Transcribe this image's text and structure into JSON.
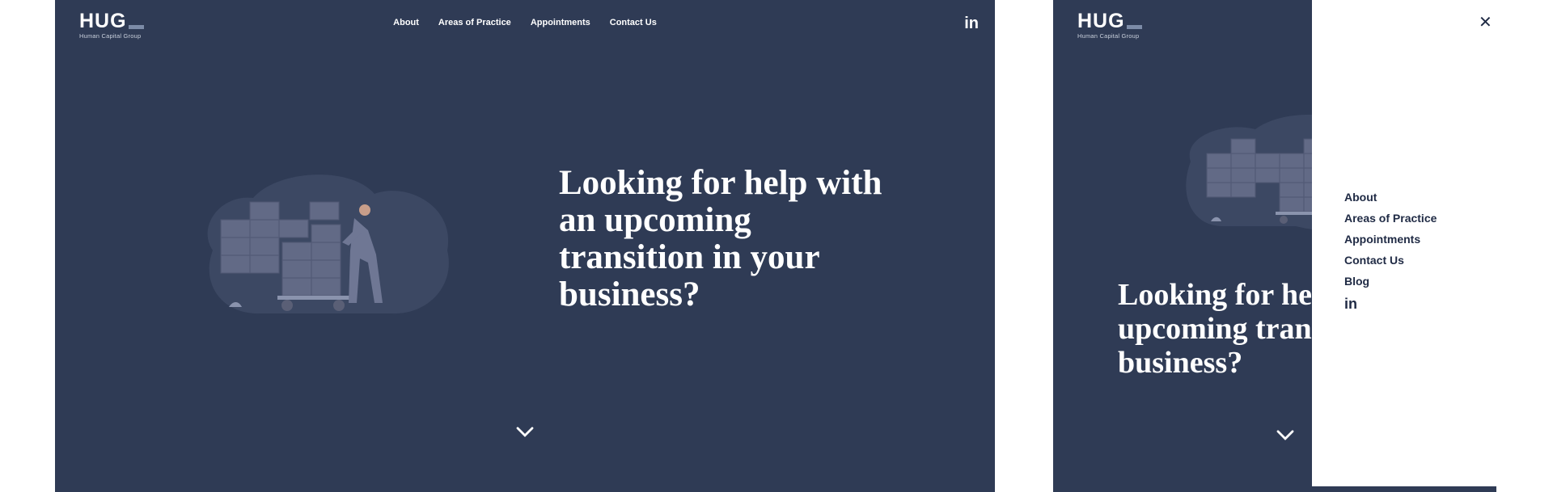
{
  "brand": {
    "logo": "HUG",
    "tagline": "Human Capital Group"
  },
  "nav": [
    {
      "label": "About"
    },
    {
      "label": "Areas of Practice"
    },
    {
      "label": "Appointments"
    },
    {
      "label": "Contact Us"
    }
  ],
  "social": {
    "linkedin": "in"
  },
  "hero": {
    "headline": "Looking for help with an upcoming transition in your business?"
  },
  "mobile_menu": {
    "items": [
      {
        "label": "About"
      },
      {
        "label": "Areas of Practice"
      },
      {
        "label": "Appointments"
      },
      {
        "label": "Contact Us"
      },
      {
        "label": "Blog"
      }
    ],
    "close_icon": "close-icon",
    "linkedin": "in"
  },
  "colors": {
    "page_bg": "#ffffff",
    "hero_bg": "#2f3b55",
    "text_light": "#ffffff",
    "text_dark": "#1f2a44",
    "accent": "#7c8ba7"
  },
  "icons": [
    "chevron-down-icon",
    "linkedin-icon",
    "close-icon"
  ]
}
